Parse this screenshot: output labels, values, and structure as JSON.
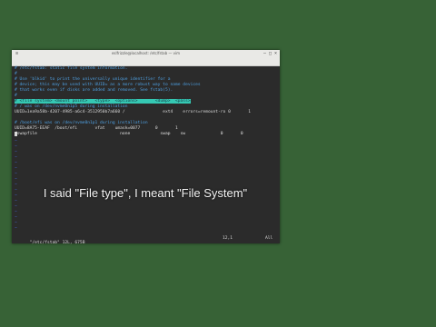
{
  "window": {
    "title": "eslfrizzle@localhost: /etc/fstab — vim",
    "menus": [
      "File",
      "Edit",
      "View",
      "Search",
      "Terminal",
      "Help"
    ]
  },
  "editor": {
    "lines": [
      "# /etc/fstab: static file system information.",
      "#",
      "# Use 'blkid' to print the universally unique identifier for a",
      "# device; this may be used with UUID= as a more robust way to name devices",
      "# that works even if disks are added and removed. See fstab(5).",
      "#",
      "# <file system> <mount point>   <type>  <options>       <dump>  <pass>",
      "# / was on /dev/nvme0n1p5 during installation",
      "UUID=1ea9a58b-4207-4985-a6c4-3512950b7a660 /               ext4    errors=remount-ro 0       1",
      "# /boot/efi was on /dev/nvme0n1p1 during installation",
      "UUID=8A75-EEAF  /boot/efi       vfat    umask=0077      0       1",
      "/swapfile                                 none            swap    sw              0       0"
    ],
    "tilde": "~",
    "status_left": "\"/etc/fstab\" 12L, 675B",
    "status_pos": "12,1",
    "status_scroll": "All"
  },
  "caption": "I said \"File type\", I meant \"File System\""
}
